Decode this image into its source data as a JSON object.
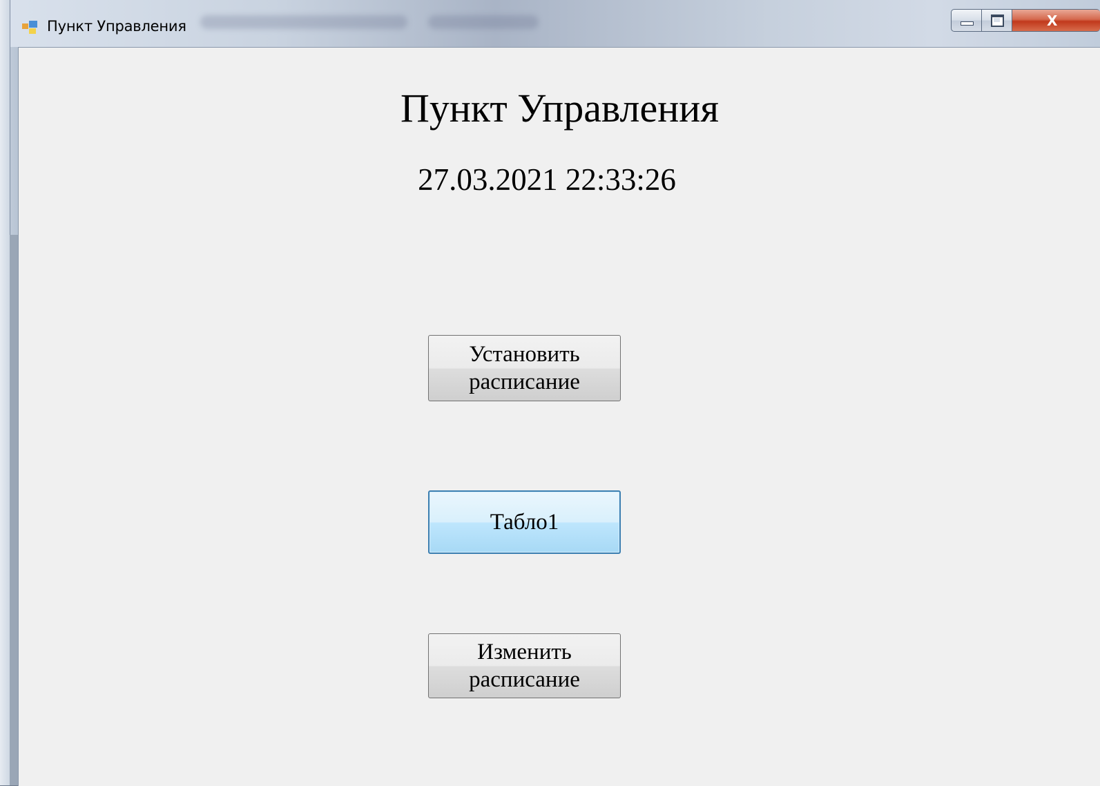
{
  "window": {
    "title": "Пункт Управления",
    "caption_buttons": {
      "minimize_icon": "minimize-icon",
      "maximize_icon": "maximize-icon",
      "close_glyph": "X"
    }
  },
  "main": {
    "heading": "Пункт Управления",
    "datetime": "27.03.2021 22:33:26",
    "buttons": {
      "set_schedule": "Установить\nрасписание",
      "tablo": "Табло1",
      "edit_schedule": "Изменить\nрасписание"
    }
  },
  "colors": {
    "client_background": "#f0f0f0",
    "focused_border": "#3c7fb1",
    "close_button": "#c1391c"
  }
}
